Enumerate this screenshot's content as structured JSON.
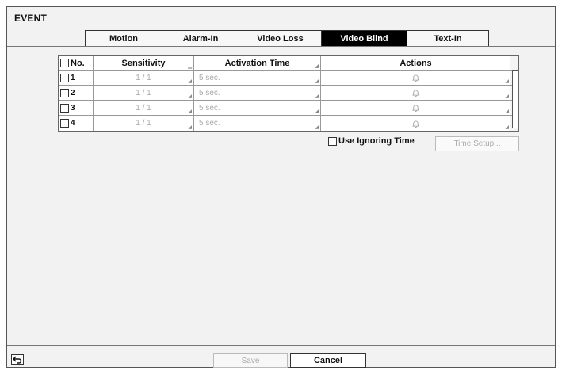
{
  "page": {
    "title": "EVENT"
  },
  "tabs": [
    {
      "label": "Motion",
      "active": false
    },
    {
      "label": "Alarm-In",
      "active": false
    },
    {
      "label": "Video Loss",
      "active": false
    },
    {
      "label": "Video Blind",
      "active": true
    },
    {
      "label": "Text-In",
      "active": false
    }
  ],
  "table": {
    "headers": {
      "no": "No.",
      "sensitivity": "Sensitivity",
      "activation_time": "Activation Time",
      "actions": "Actions"
    },
    "rows": [
      {
        "no": "1",
        "sensitivity": "1 / 1",
        "activation_time": "5 sec.",
        "action_icon": "bell-icon"
      },
      {
        "no": "2",
        "sensitivity": "1 / 1",
        "activation_time": "5 sec.",
        "action_icon": "bell-icon"
      },
      {
        "no": "3",
        "sensitivity": "1 / 1",
        "activation_time": "5 sec.",
        "action_icon": "bell-icon"
      },
      {
        "no": "4",
        "sensitivity": "1 / 1",
        "activation_time": "5 sec.",
        "action_icon": "bell-icon"
      }
    ]
  },
  "options": {
    "use_ignoring_time": "Use Ignoring Time",
    "time_setup": "Time Setup..."
  },
  "footer": {
    "back_icon": "back-arrow-icon",
    "save": "Save",
    "cancel": "Cancel"
  }
}
